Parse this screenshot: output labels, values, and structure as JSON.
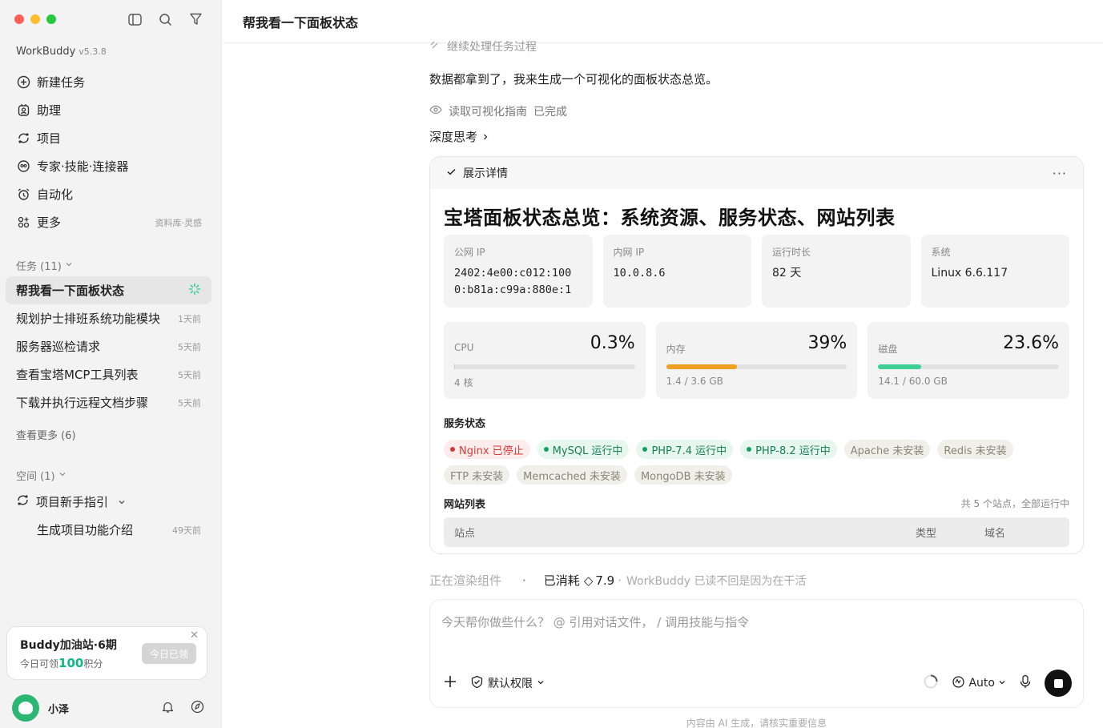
{
  "sidebar": {
    "app_name": "WorkBuddy",
    "version": "v5.3.8",
    "nav": [
      {
        "label": "新建任务",
        "icon": "plus-circle-icon"
      },
      {
        "label": "助理",
        "icon": "assistant-icon"
      },
      {
        "label": "项目",
        "icon": "project-icon"
      },
      {
        "label": "专家·技能·连接器",
        "icon": "expert-icon"
      },
      {
        "label": "自动化",
        "icon": "alarm-clock-icon"
      },
      {
        "label": "更多",
        "icon": "grid-icon",
        "extra": "资料库·灵感"
      }
    ],
    "tasks_label": "任务 (11)",
    "tasks": [
      {
        "label": "帮我看一下面板状态",
        "time": ""
      },
      {
        "label": "规划护士排班系统功能模块",
        "time": "1天前"
      },
      {
        "label": "服务器巡检请求",
        "time": "5天前"
      },
      {
        "label": "查看宝塔MCP工具列表",
        "time": "5天前"
      },
      {
        "label": "下载并执行远程文档步骤",
        "time": "5天前"
      }
    ],
    "see_more": "查看更多 (6)",
    "space_label": "空间 (1)",
    "space_item": "项目新手指引",
    "space_sub": {
      "label": "生成项目功能介绍",
      "time": "49天前"
    },
    "promo": {
      "title": "Buddy加油站·6期",
      "sub_prefix": "今日可领",
      "sub_num": "100",
      "sub_suffix": "积分",
      "button": "今日已领"
    },
    "user": {
      "name": "小泽"
    }
  },
  "header": {
    "title": "帮我看一下面板状态"
  },
  "chat": {
    "faded_step": "继续处理任务过程",
    "message": "数据都拿到了，我来生成一个可视化的面板状态总览。",
    "step_label": "读取可视化指南",
    "step_status": "已完成",
    "deep_think": "深度思考"
  },
  "card": {
    "toggle": "展示详情",
    "title": "宝塔面板状态总览：系统资源、服务状态、网站列表",
    "info": [
      {
        "label": "公网 IP",
        "value": "2402:4e00:c012:100\n0:b81a:c99a:880e:1",
        "mono": true
      },
      {
        "label": "内网 IP",
        "value": "10.0.8.6",
        "mono": true
      },
      {
        "label": "运行时长",
        "value": "82 天",
        "mono": false
      },
      {
        "label": "系统",
        "value": "Linux 6.6.117",
        "mono": false
      }
    ],
    "metrics": [
      {
        "label": "CPU",
        "pct": "0.3%",
        "fraction": 0.003,
        "sub": "4 核",
        "color": "#c8c8c8"
      },
      {
        "label": "内存",
        "pct": "39%",
        "fraction": 0.39,
        "sub": "1.4 / 3.6 GB",
        "color": "#f0a020"
      },
      {
        "label": "磁盘",
        "pct": "23.6%",
        "fraction": 0.236,
        "sub": "14.1 / 60.0 GB",
        "color": "#3dcf93"
      }
    ],
    "services_title": "服务状态",
    "services": [
      {
        "label": "Nginx 已停止",
        "state": "stop"
      },
      {
        "label": "MySQL 运行中",
        "state": "run"
      },
      {
        "label": "PHP-7.4 运行中",
        "state": "run"
      },
      {
        "label": "PHP-8.2 运行中",
        "state": "run"
      },
      {
        "label": "Apache 未安装",
        "state": "none"
      },
      {
        "label": "Redis 未安装",
        "state": "none"
      },
      {
        "label": "FTP 未安装",
        "state": "none"
      },
      {
        "label": "Memcached 未安装",
        "state": "none"
      },
      {
        "label": "MongoDB 未安装",
        "state": "none"
      }
    ],
    "sites_title": "网站列表",
    "sites_count": "共 5 个站点，全部运行中",
    "table_cols": [
      "站点",
      "类型",
      "域名"
    ]
  },
  "status": {
    "rendering": "正在渲染组件",
    "consumed": "已消耗",
    "credits": "7.9",
    "note": "WorkBuddy 已读不回是因为在干活"
  },
  "composer": {
    "placeholder": "今天帮你做些什么？ @ 引用对话文件， / 调用技能与指令",
    "permission": "默认权限",
    "model": "Auto"
  },
  "footer_note": "内容由 AI 生成，请核实重要信息"
}
